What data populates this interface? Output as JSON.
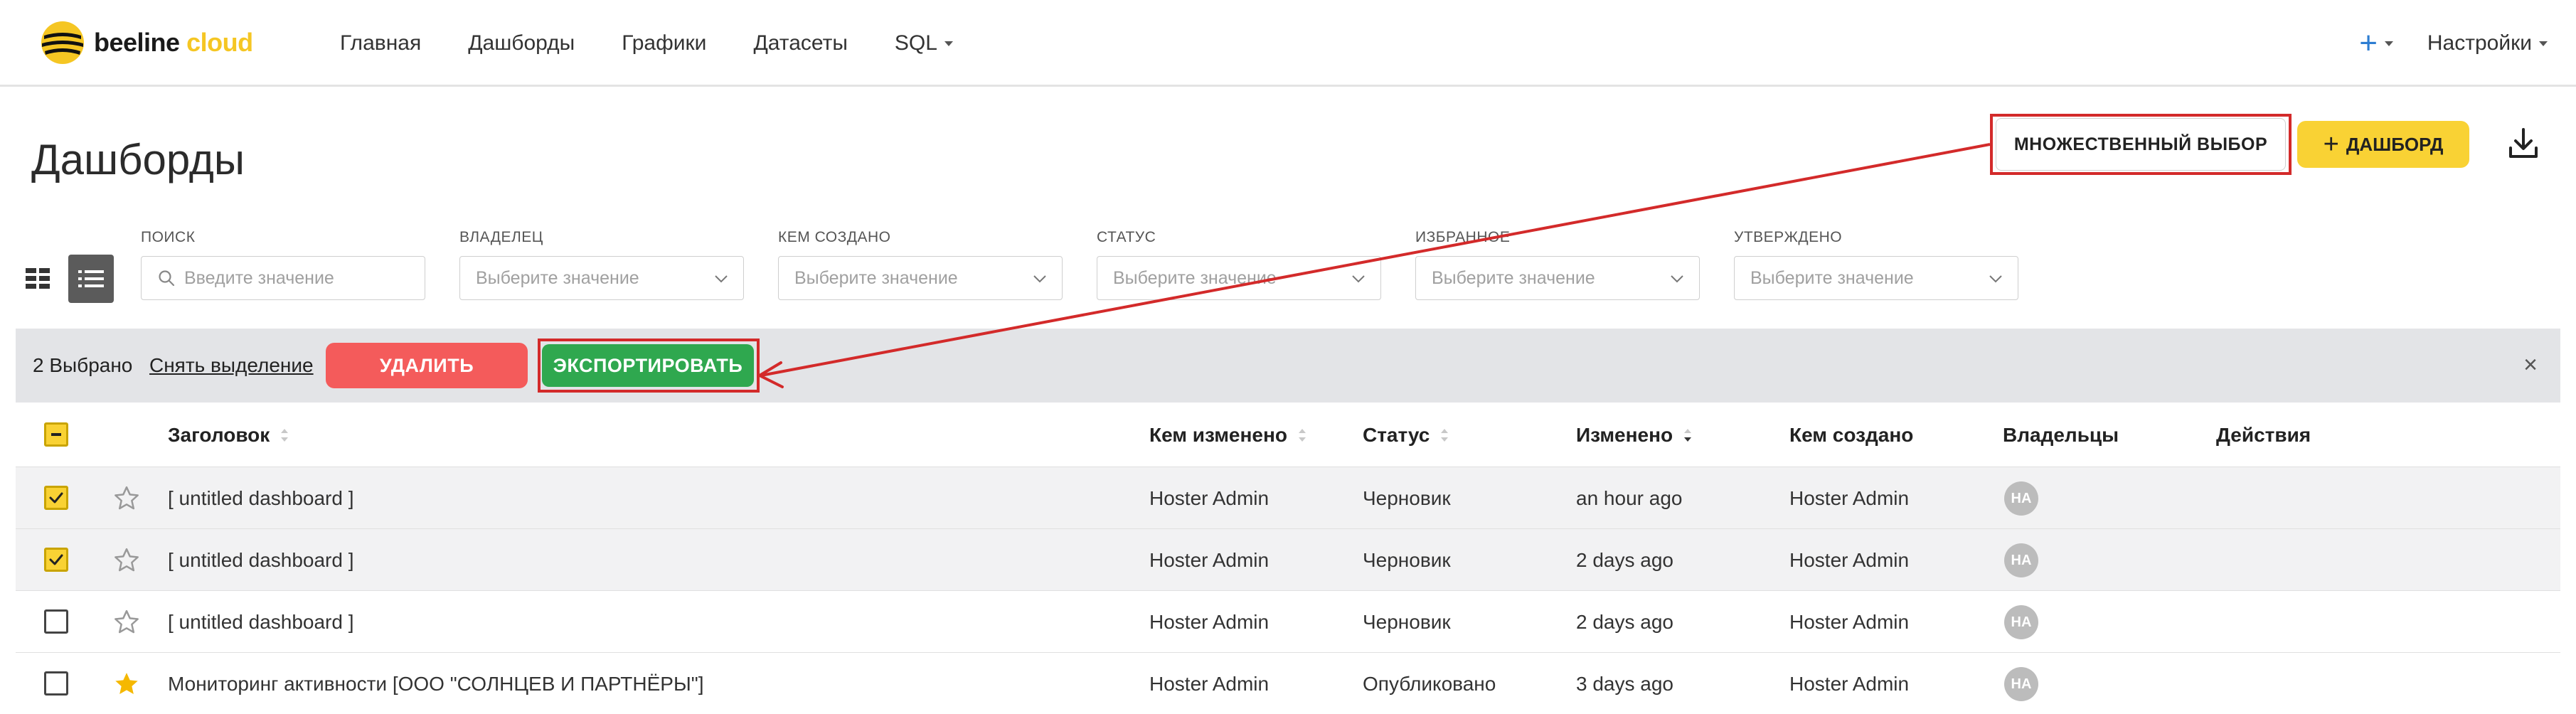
{
  "brand": {
    "name_part1": "beeline",
    "name_part2": "cloud"
  },
  "nav": {
    "items": [
      {
        "label": "Главная"
      },
      {
        "label": "Дашборды"
      },
      {
        "label": "Графики"
      },
      {
        "label": "Датасеты"
      },
      {
        "label": "SQL"
      }
    ],
    "plus_icon": "plus-icon",
    "settings_label": "Настройки"
  },
  "page": {
    "title": "Дашборды",
    "multi_select_label": "МНОЖЕСТВЕННЫЙ ВЫБОР",
    "add_dashboard_label": "ДАШБОРД",
    "add_dashboard_plus": "+",
    "download_icon": "download-icon"
  },
  "filters": [
    {
      "label": "ПОИСК",
      "placeholder": "Введите значение"
    },
    {
      "label": "ВЛАДЕЛЕЦ",
      "placeholder": "Выберите значение"
    },
    {
      "label": "КЕМ СОЗДАНО",
      "placeholder": "Выберите значение"
    },
    {
      "label": "СТАТУС",
      "placeholder": "Выберите значение"
    },
    {
      "label": "ИЗБРАННОЕ",
      "placeholder": "Выберите значение"
    },
    {
      "label": "УТВЕРЖДЕНО",
      "placeholder": "Выберите значение"
    }
  ],
  "selection_bar": {
    "count_label": "2 Выбрано",
    "clear_label": "Снять выделение",
    "delete_label": "УДАЛИТЬ",
    "export_label": "ЭКСПОРТИРОВАТЬ",
    "close_glyph": "×"
  },
  "table": {
    "columns": [
      {
        "label": "Заголовок"
      },
      {
        "label": "Кем изменено"
      },
      {
        "label": "Статус"
      },
      {
        "label": "Изменено"
      },
      {
        "label": "Кем создано"
      },
      {
        "label": "Владельцы"
      },
      {
        "label": "Действия"
      }
    ],
    "rows": [
      {
        "checked": true,
        "favorite": false,
        "title": "[ untitled dashboard ]",
        "changed_by": "Hoster Admin",
        "status": "Черновик",
        "modified": "an hour ago",
        "created_by": "Hoster Admin",
        "owner_initials": "HA"
      },
      {
        "checked": true,
        "favorite": false,
        "title": "[ untitled dashboard ]",
        "changed_by": "Hoster Admin",
        "status": "Черновик",
        "modified": "2 days ago",
        "created_by": "Hoster Admin",
        "owner_initials": "HA"
      },
      {
        "checked": false,
        "favorite": false,
        "title": "[ untitled dashboard ]",
        "changed_by": "Hoster Admin",
        "status": "Черновик",
        "modified": "2 days ago",
        "created_by": "Hoster Admin",
        "owner_initials": "HA"
      },
      {
        "checked": false,
        "favorite": true,
        "title": "Мониторинг активности [ООО \"СОЛНЦЕВ И ПАРТНЁРЫ\"]",
        "changed_by": "Hoster Admin",
        "status": "Опубликовано",
        "modified": "3 days ago",
        "created_by": "Hoster Admin",
        "owner_initials": "HA"
      }
    ]
  },
  "colors": {
    "accent_yellow": "#f9d234",
    "delete_red": "#f45b5b",
    "export_green": "#2fa84f",
    "annotation_red": "#d32a2a"
  }
}
